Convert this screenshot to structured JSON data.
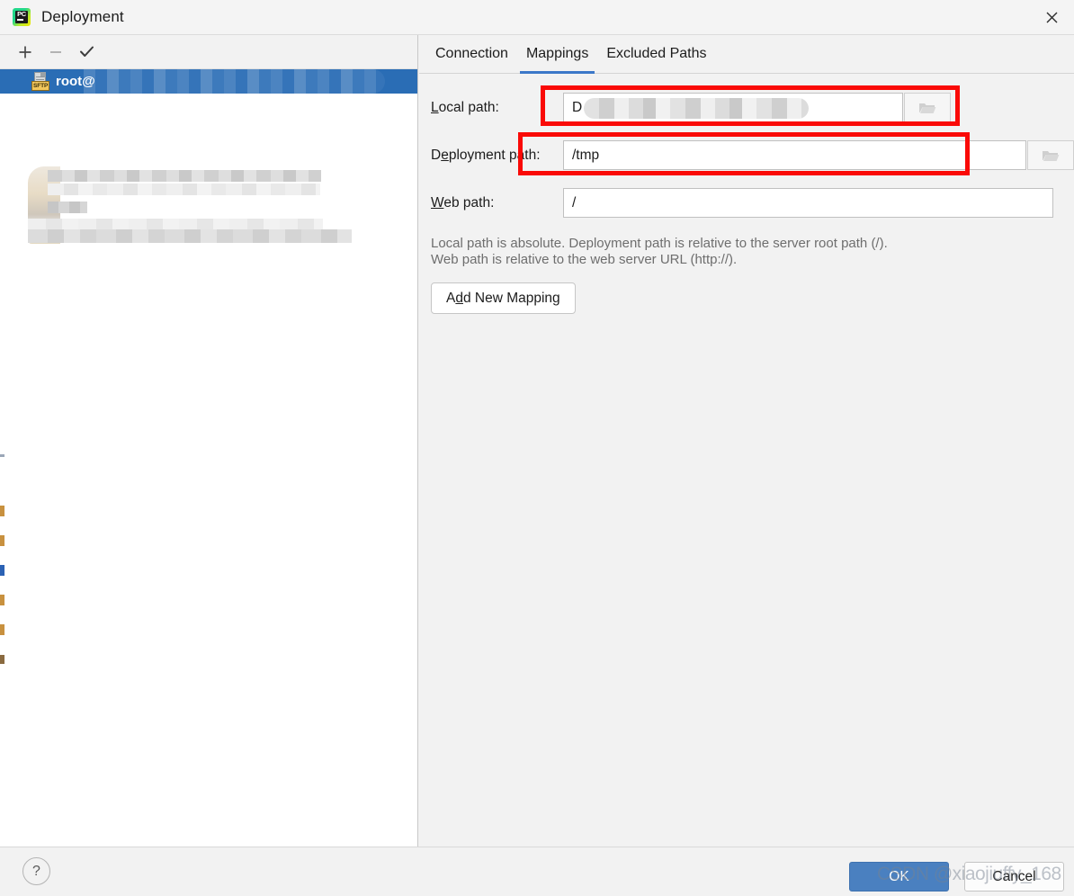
{
  "window": {
    "title": "Deployment",
    "app_icon": "pycharm-icon",
    "icon_text": "PC",
    "close_icon": "close-icon"
  },
  "left_panel": {
    "toolbar": {
      "add": {
        "icon": "plus-icon",
        "label": "+"
      },
      "remove": {
        "icon": "minus-icon",
        "label": "−"
      },
      "set_default": {
        "icon": "check-icon",
        "label": "✓"
      }
    },
    "servers": [
      {
        "name": "root@",
        "type_badge": "SFTP",
        "icon": "sftp-server-icon",
        "selected": true
      }
    ]
  },
  "tabs": [
    {
      "label": "Connection",
      "active": false
    },
    {
      "label": "Mappings",
      "active": true
    },
    {
      "label": "Excluded Paths",
      "active": false
    }
  ],
  "mappings": {
    "local_path": {
      "label_pre": "L",
      "label_post": "ocal path:",
      "value": "D",
      "browse_icon": "folder-open-icon"
    },
    "deployment_path": {
      "label_pre": "D",
      "label_mid": "e",
      "label_post": "ployment path:",
      "value": "/tmp",
      "browse_icon": "folder-open-icon"
    },
    "web_path": {
      "label_pre": "W",
      "label_post": "eb path:",
      "value": "/"
    },
    "hint_line_1": "Local path is absolute. Deployment path is relative to the server root path (/).",
    "hint_line_2": "Web path is relative to the web server URL (http://).",
    "add_new_mapping": {
      "pre": "A",
      "mnemonic": "d",
      "post": "d New Mapping"
    }
  },
  "footer": {
    "help": {
      "icon": "help-icon",
      "label": "?"
    },
    "ok_label": "OK",
    "cancel_label": "Cancel",
    "watermark": "CSDN @xiaojiuffy_168"
  },
  "colors": {
    "accent_blue": "#3c78c8",
    "selection_blue": "#2a6db5",
    "ok_button_blue": "#4a80c0",
    "annotation_red": "#fa0a07",
    "sftp_badge_yellow": "#f2c75c",
    "window_bg": "#f2f2f2",
    "panel_white": "#ffffff",
    "hint_gray": "#6e6e6e"
  }
}
